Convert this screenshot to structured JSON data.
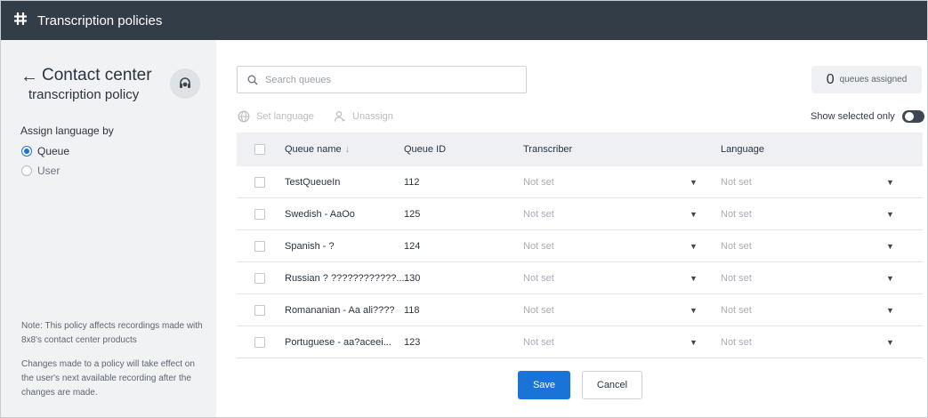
{
  "header": {
    "icon": "hash-icon",
    "title": "Transcription policies"
  },
  "sidebar": {
    "back_icon": "←",
    "title": "Contact center",
    "subtitle": "transcription policy",
    "avatar_icon": "headset-icon",
    "assign_label": "Assign language by",
    "options": [
      {
        "label": "Queue",
        "selected": true
      },
      {
        "label": "User",
        "selected": false
      }
    ],
    "note1": "Note: This policy affects recordings made with 8x8's contact center products",
    "note2": "Changes made to a policy will take effect on the user's next available recording after the changes are made."
  },
  "search": {
    "placeholder": "Search queues",
    "value": ""
  },
  "assigned": {
    "count": "0",
    "label": "queues assigned"
  },
  "actions": {
    "set_language": "Set language",
    "unassign": "Unassign"
  },
  "show_selected": {
    "label": "Show selected only",
    "on": true
  },
  "table": {
    "columns": {
      "name": "Queue name",
      "id": "Queue ID",
      "transcriber": "Transcriber",
      "language": "Language"
    },
    "sort_icon": "↓",
    "rows": [
      {
        "name": "TestQueueIn",
        "id": "112",
        "transcriber": "Not set",
        "language": "Not set"
      },
      {
        "name": "Swedish - AaOo",
        "id": "125",
        "transcriber": "Not set",
        "language": "Not set"
      },
      {
        "name": "Spanish - ?",
        "id": "124",
        "transcriber": "Not set",
        "language": "Not set"
      },
      {
        "name": "Russian ? ????????????...",
        "id": "130",
        "transcriber": "Not set",
        "language": "Not set"
      },
      {
        "name": "Romananian - Aa ali????",
        "id": "118",
        "transcriber": "Not set",
        "language": "Not set"
      },
      {
        "name": "Portuguese - aa?aceei...",
        "id": "123",
        "transcriber": "Not set",
        "language": "Not set"
      }
    ]
  },
  "buttons": {
    "save": "Save",
    "cancel": "Cancel"
  },
  "colors": {
    "topbar": "#333d48",
    "primary": "#1a73d6",
    "sidebar": "#f1f2f4"
  }
}
